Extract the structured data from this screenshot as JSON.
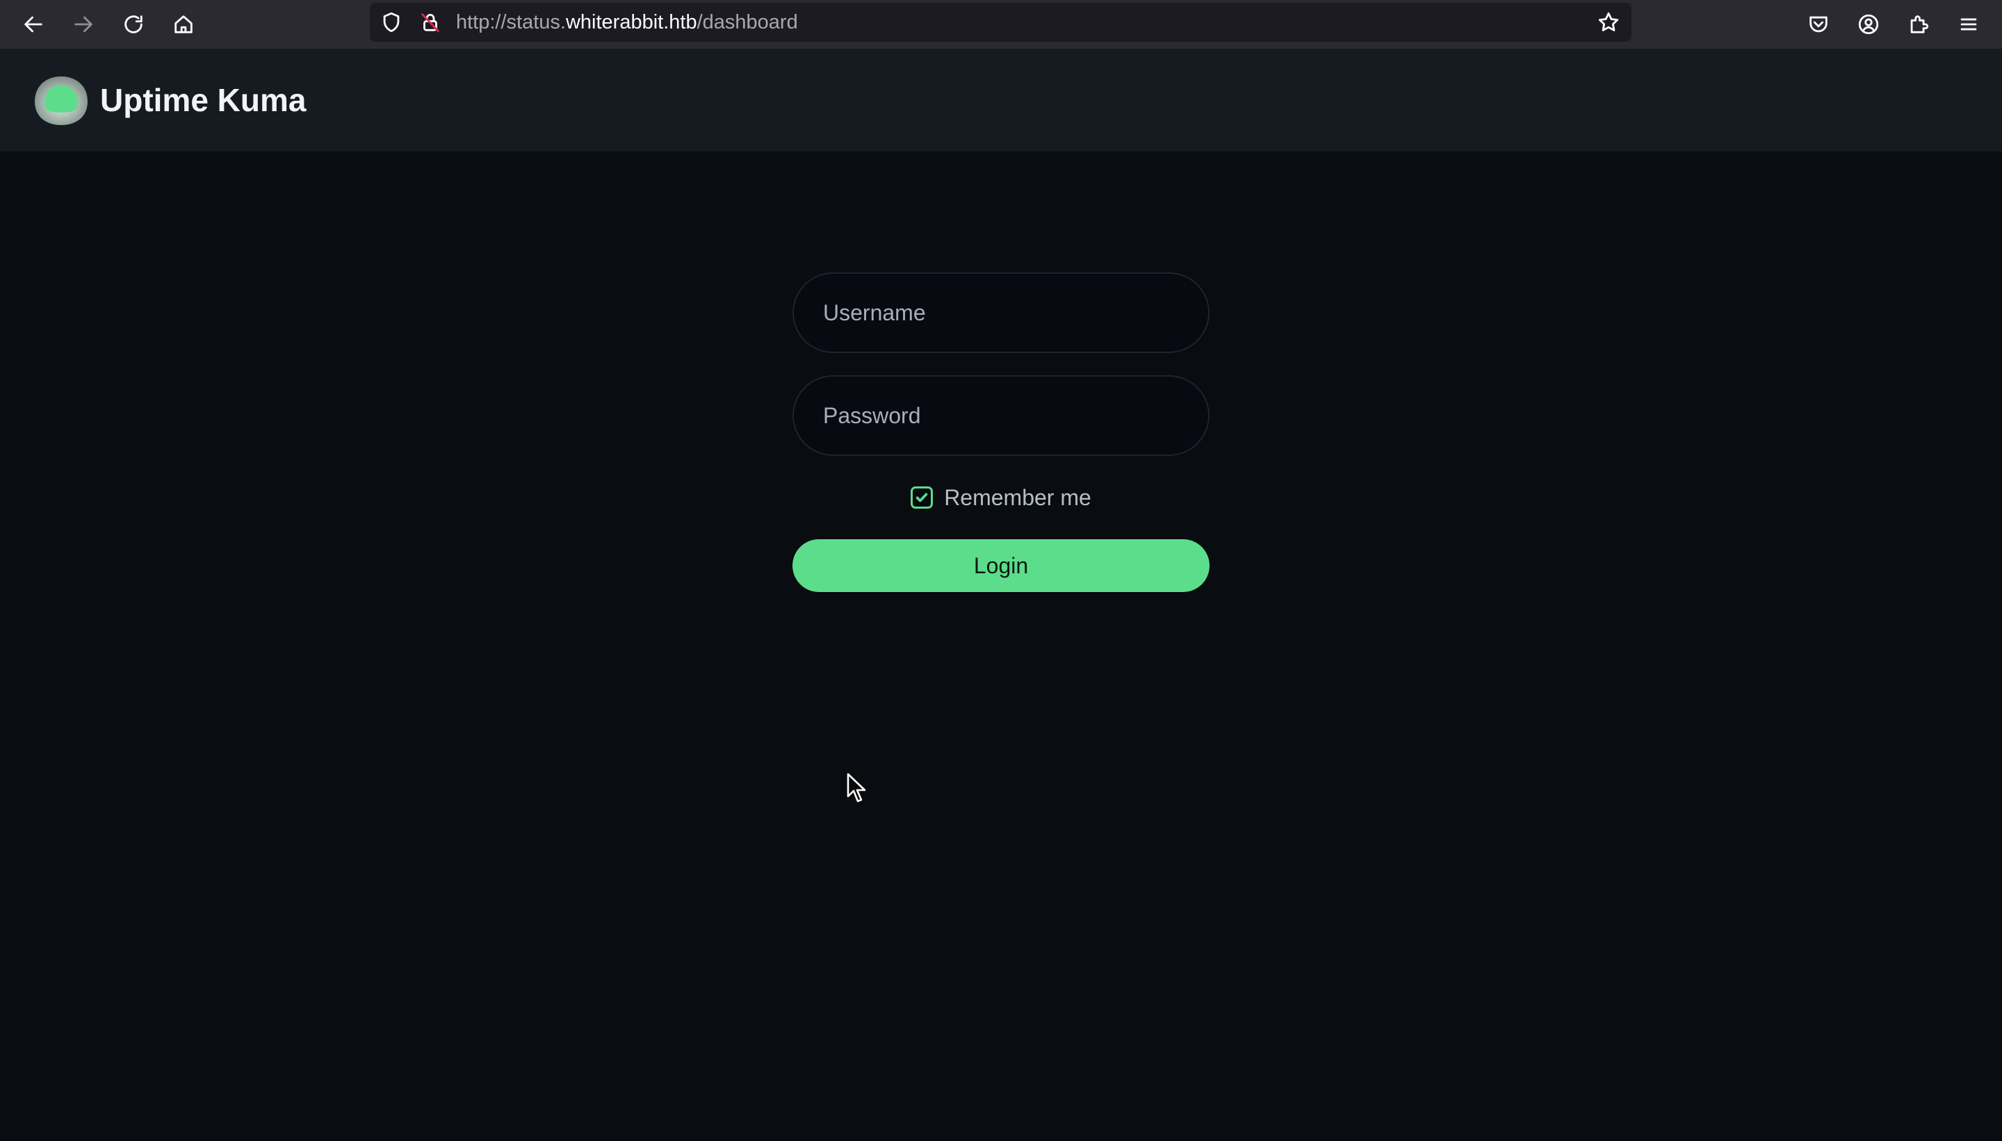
{
  "browser": {
    "url_prefix": "http://status.",
    "url_host": "whiterabbit.htb",
    "url_path": "/dashboard"
  },
  "app": {
    "title": "Uptime Kuma"
  },
  "login": {
    "username_placeholder": "Username",
    "password_placeholder": "Password",
    "remember_label": "Remember me",
    "remember_checked": true,
    "login_label": "Login"
  },
  "colors": {
    "accent": "#5cdd8b",
    "background": "#090c10",
    "header": "#161b22",
    "browser_toolbar": "#2b2a33"
  },
  "icons": {
    "back": "arrow-left-icon",
    "forward": "arrow-right-icon",
    "reload": "reload-icon",
    "home": "home-icon",
    "shield": "shield-icon",
    "lock": "lock-insecure-icon",
    "bookmark": "star-icon",
    "pocket": "pocket-icon",
    "account": "account-icon",
    "extensions": "puzzle-icon",
    "menu": "hamburger-menu-icon"
  }
}
